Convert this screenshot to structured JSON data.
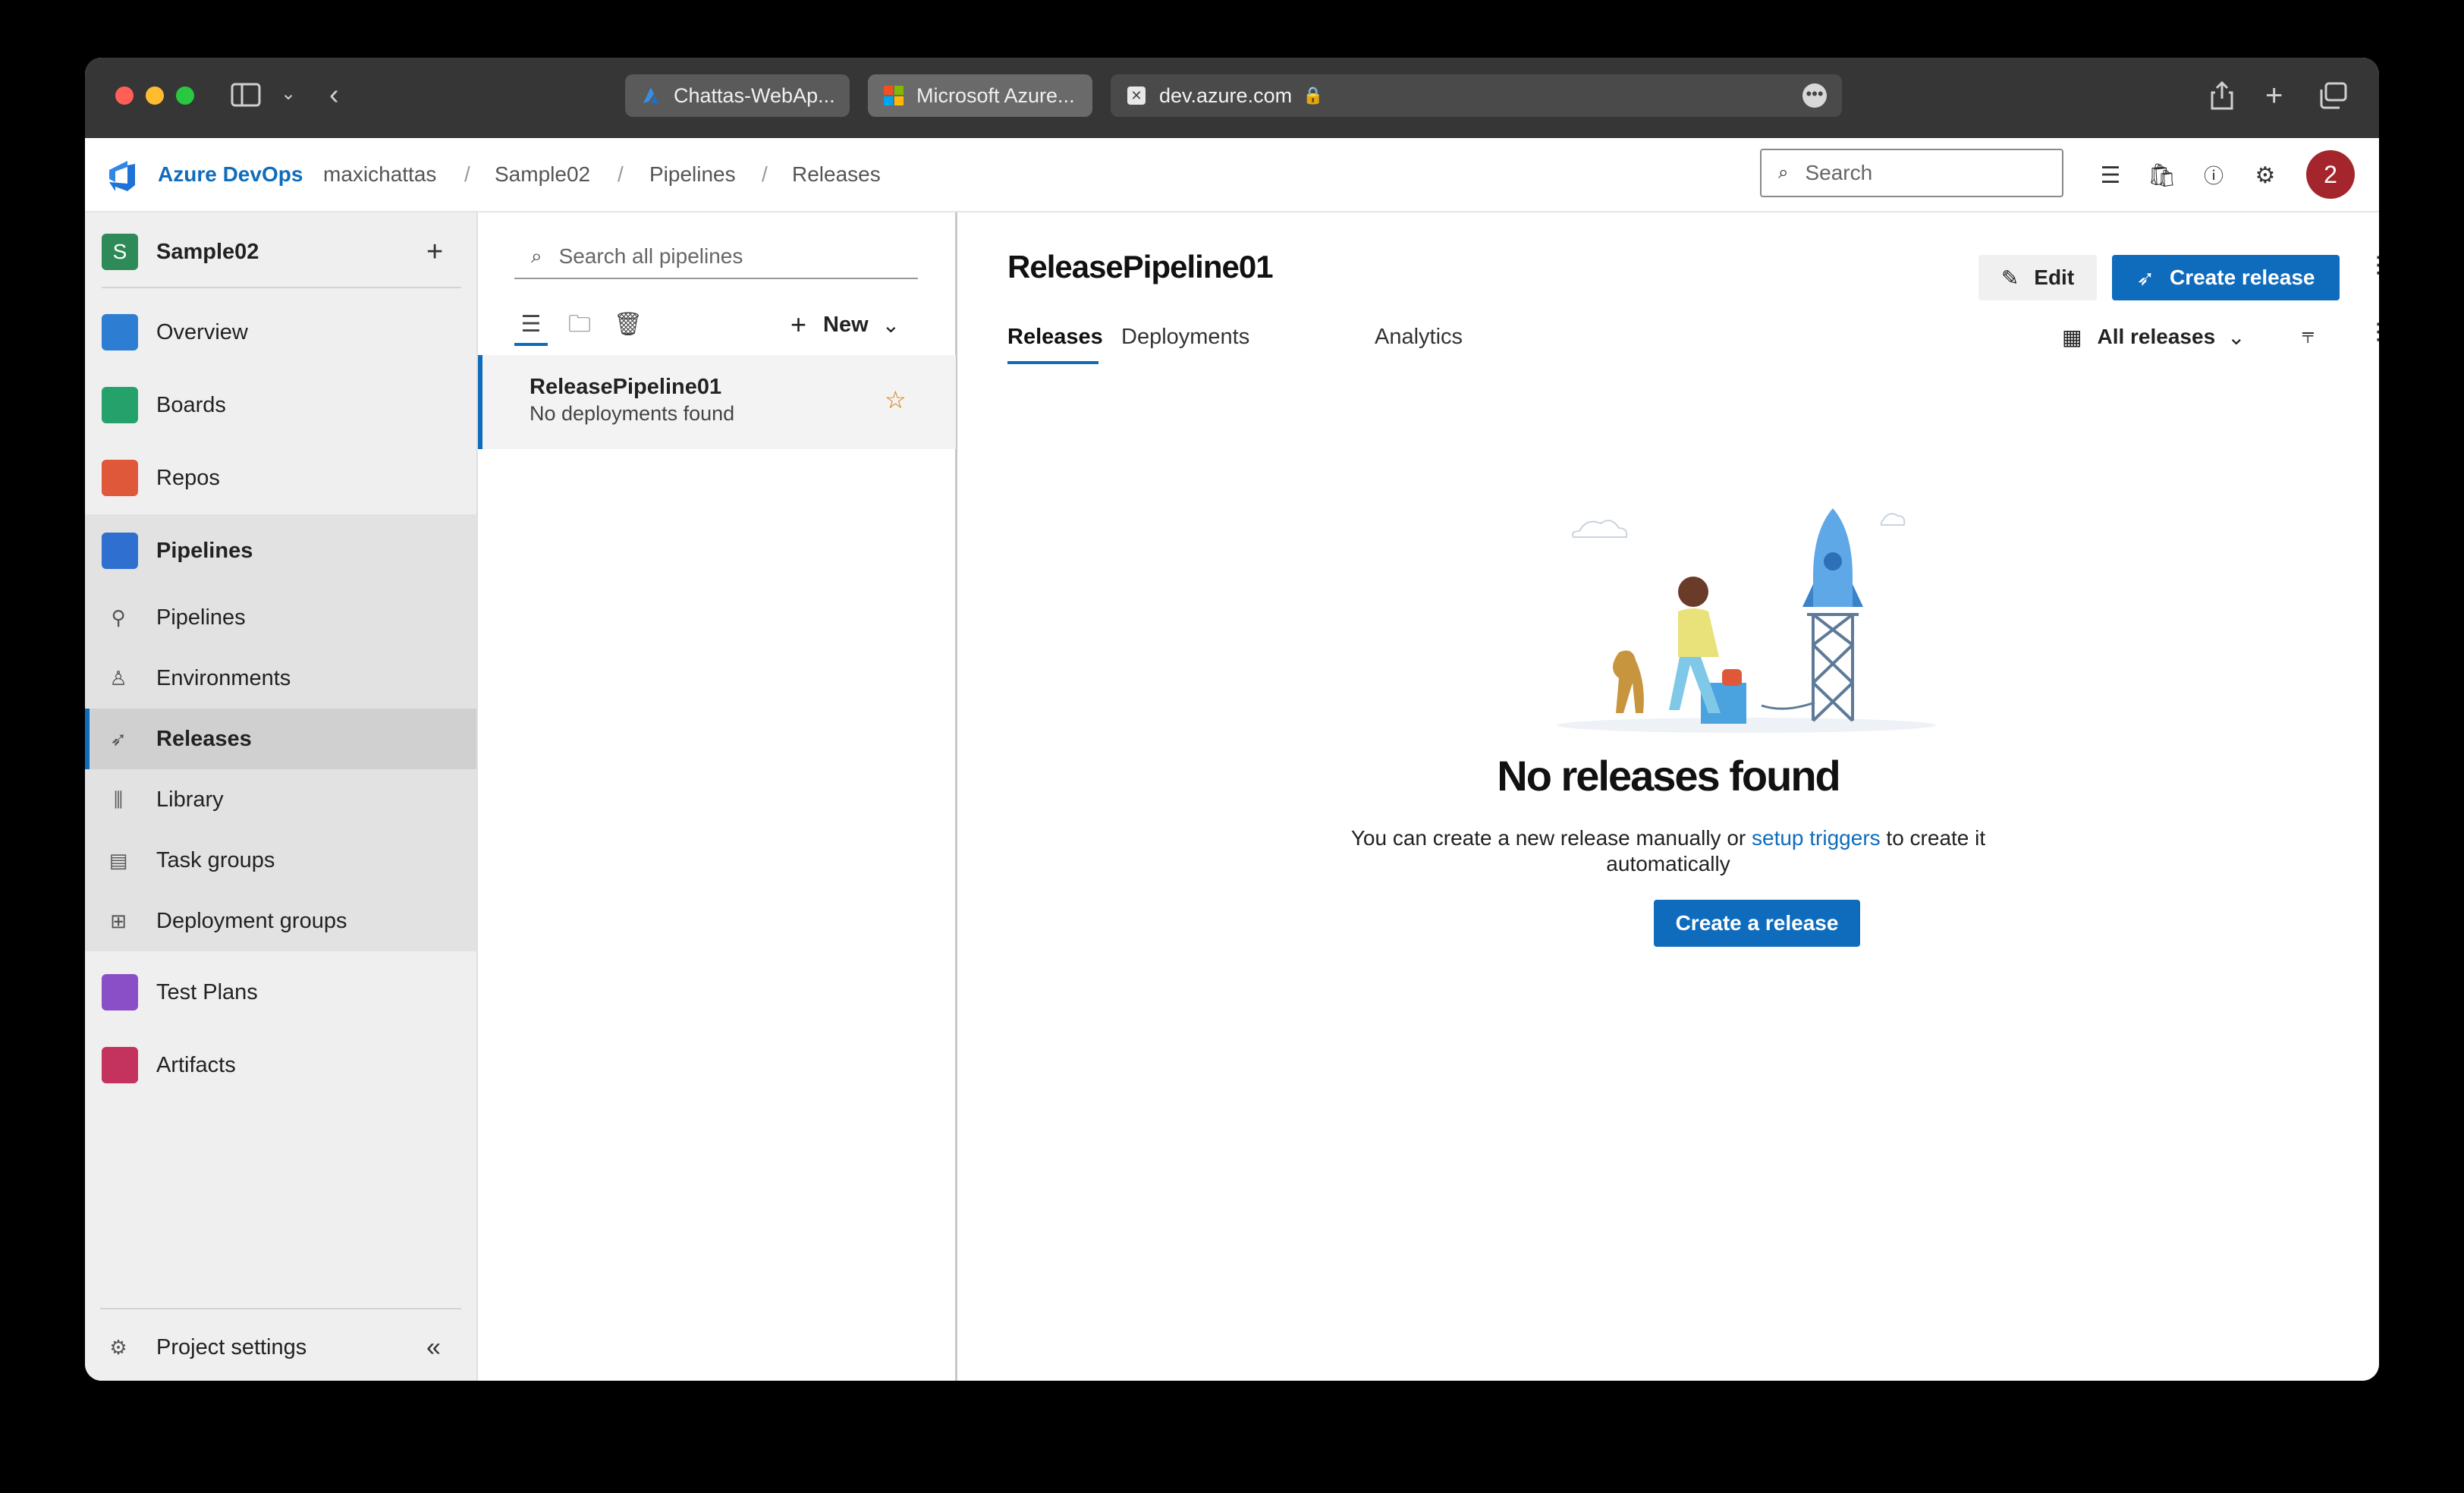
{
  "browser": {
    "tabs": [
      {
        "label": "Chattas-WebAp..."
      },
      {
        "label": "Microsoft Azure..."
      }
    ],
    "address": "dev.azure.com"
  },
  "header": {
    "brand": "Azure DevOps",
    "breadcrumbs": [
      "maxichattas",
      "Sample02",
      "Pipelines",
      "Releases"
    ],
    "search_placeholder": "Search",
    "avatar_text": "2"
  },
  "sidebar": {
    "project_initial": "S",
    "project_name": "Sample02",
    "items": [
      {
        "label": "Overview"
      },
      {
        "label": "Boards"
      },
      {
        "label": "Repos"
      },
      {
        "label": "Pipelines"
      },
      {
        "label": "Pipelines"
      },
      {
        "label": "Environments"
      },
      {
        "label": "Releases"
      },
      {
        "label": "Library"
      },
      {
        "label": "Task groups"
      },
      {
        "label": "Deployment groups"
      },
      {
        "label": "Test Plans"
      },
      {
        "label": "Artifacts"
      }
    ],
    "settings_label": "Project settings"
  },
  "list": {
    "search_placeholder": "Search all pipelines",
    "new_label": "New",
    "pipeline": {
      "name": "ReleasePipeline01",
      "status": "No deployments found"
    }
  },
  "main": {
    "title": "ReleasePipeline01",
    "edit_label": "Edit",
    "create_release_label": "Create release",
    "tabs": [
      {
        "label": "Releases"
      },
      {
        "label": "Deployments"
      },
      {
        "label": "Analytics"
      }
    ],
    "filter_label": "All releases",
    "empty": {
      "heading": "No releases found",
      "text_before": "You can create a new release manually or ",
      "link": "setup triggers",
      "text_after": " to create it automatically",
      "button": "Create a release"
    }
  },
  "colors": {
    "accent": "#0f6cbd",
    "avatar": "#a4262c"
  }
}
